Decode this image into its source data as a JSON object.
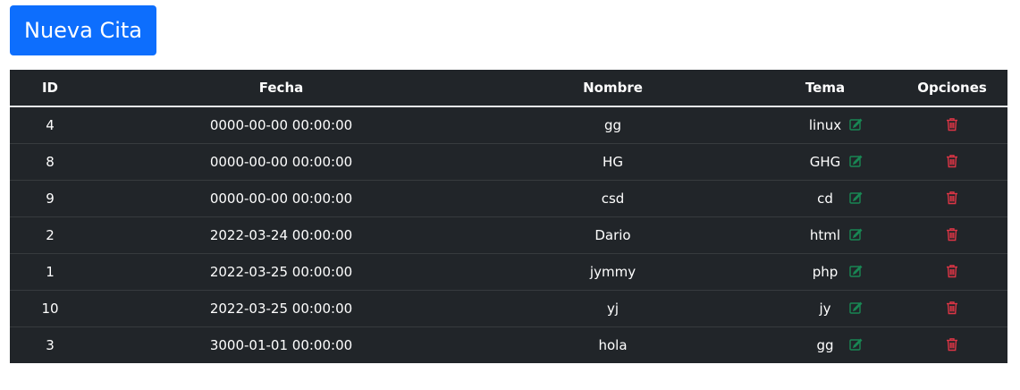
{
  "toolbar": {
    "new_button_label": "Nueva Cita",
    "new_button_color": "#0d6efd"
  },
  "table": {
    "headers": {
      "id": "ID",
      "fecha": "Fecha",
      "nombre": "Nombre",
      "tema": "Tema",
      "opciones": "Opciones"
    },
    "rows": [
      {
        "id": "4",
        "fecha": "0000-00-00 00:00:00",
        "nombre": "gg",
        "tema": "linux"
      },
      {
        "id": "8",
        "fecha": "0000-00-00 00:00:00",
        "nombre": "HG",
        "tema": "GHG"
      },
      {
        "id": "9",
        "fecha": "0000-00-00 00:00:00",
        "nombre": "csd",
        "tema": "cd"
      },
      {
        "id": "2",
        "fecha": "2022-03-24 00:00:00",
        "nombre": "Dario",
        "tema": "html"
      },
      {
        "id": "1",
        "fecha": "2022-03-25 00:00:00",
        "nombre": "jymmy",
        "tema": "php"
      },
      {
        "id": "10",
        "fecha": "2022-03-25 00:00:00",
        "nombre": "yj",
        "tema": "jy"
      },
      {
        "id": "3",
        "fecha": "3000-01-01 00:00:00",
        "nombre": "hola",
        "tema": "gg"
      }
    ],
    "row_actions": {
      "edit_icon": "edit-icon",
      "delete_icon": "trash-icon",
      "edit_color": "#198754",
      "delete_color": "#dc3545"
    },
    "background_color": "#212529"
  }
}
